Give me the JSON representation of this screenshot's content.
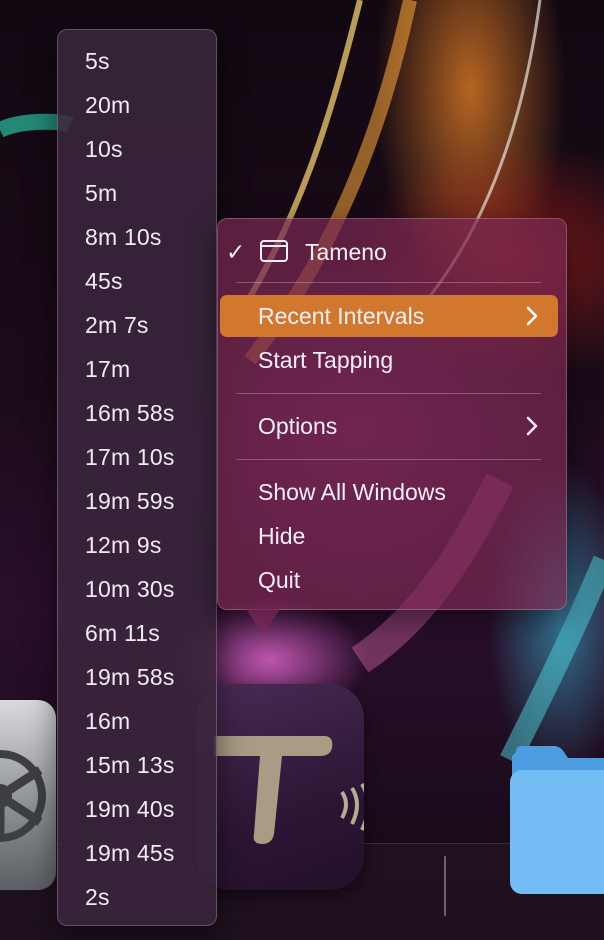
{
  "recent_intervals": [
    "5s",
    "20m",
    "10s",
    "5m",
    "8m 10s",
    "45s",
    "2m 7s",
    "17m",
    "16m 58s",
    "17m 10s",
    "19m 59s",
    "12m 9s",
    "10m 30s",
    "6m 11s",
    "19m 58s",
    "16m",
    "15m 13s",
    "19m 40s",
    "19m 45s",
    "2s"
  ],
  "menu": {
    "app_title": "Tameno",
    "app_checked": "✓",
    "recent_intervals": "Recent Intervals",
    "start_tapping": "Start Tapping",
    "options": "Options",
    "show_all_windows": "Show All Windows",
    "hide": "Hide",
    "quit": "Quit"
  },
  "icons": {
    "window": "window-icon",
    "chevron": "chevron-right-icon",
    "settings": "system-settings-icon",
    "tameno": "tameno-app-icon",
    "folder": "folder-icon"
  },
  "colors": {
    "highlight": "#d1772e",
    "menu_bg": "rgba(120,40,80,0.72)",
    "submenu_bg": "rgba(58,38,62,0.86)"
  }
}
